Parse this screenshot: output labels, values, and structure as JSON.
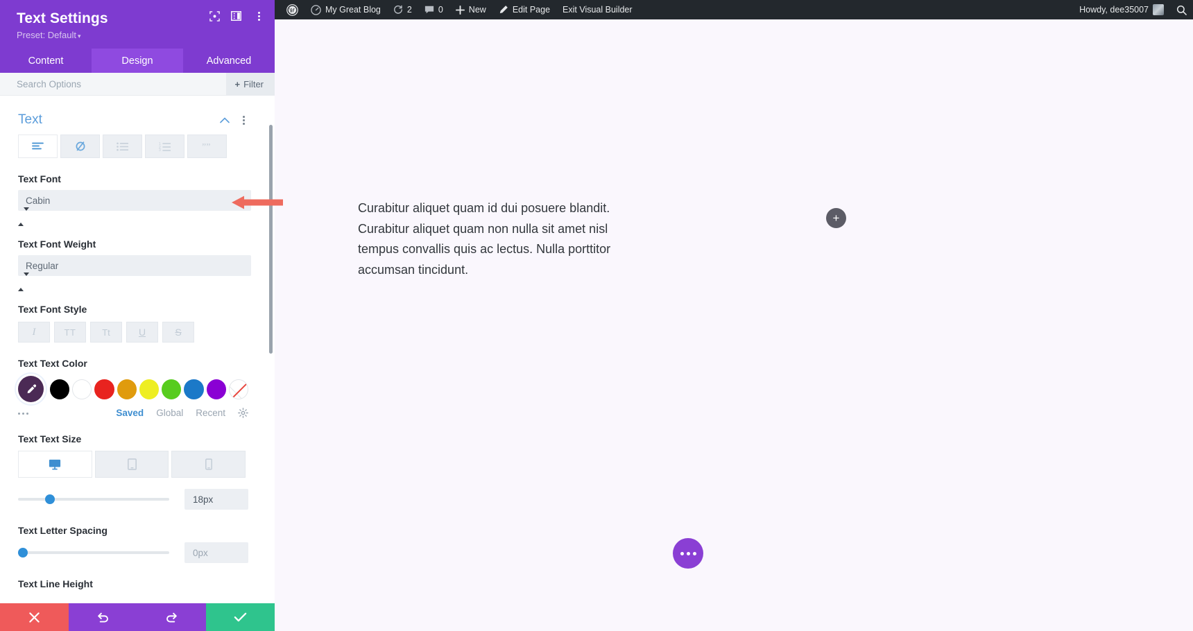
{
  "panel": {
    "title": "Text Settings",
    "preset_label": "Preset: Default",
    "preset_caret": "▾",
    "header_icons": [
      "focus-frame-icon",
      "layout-columns-icon",
      "kebab-menu-icon"
    ],
    "tabs": [
      {
        "label": "Content",
        "active": false
      },
      {
        "label": "Design",
        "active": true
      },
      {
        "label": "Advanced",
        "active": false
      }
    ],
    "search": {
      "placeholder": "Search Options",
      "value": ""
    },
    "filter_button": {
      "plus": "+",
      "label": "Filter"
    },
    "section": {
      "title": "Text",
      "collapse_icon": "chevron-up-icon",
      "menu_icon": "kebab-menu-icon"
    },
    "align_buttons": [
      {
        "name": "text-align-left",
        "active": true
      },
      {
        "name": "text-orientation",
        "active": false
      },
      {
        "name": "unordered-list",
        "active": false
      },
      {
        "name": "ordered-list",
        "active": false
      },
      {
        "name": "blockquote",
        "active": false
      }
    ],
    "fields": {
      "text_font": {
        "label": "Text Font",
        "value": "Cabin"
      },
      "text_font_weight": {
        "label": "Text Font Weight",
        "value": "Regular"
      },
      "text_font_style": {
        "label": "Text Font Style",
        "buttons": [
          {
            "name": "italic",
            "glyph": "I",
            "active": false
          },
          {
            "name": "uppercase",
            "glyph": "TT",
            "active": false
          },
          {
            "name": "capitalize",
            "glyph": "Tt",
            "active": false
          },
          {
            "name": "underline",
            "glyph": "U",
            "active": false
          },
          {
            "name": "strikethrough",
            "glyph": "S",
            "active": false
          }
        ]
      },
      "text_text_color": {
        "label": "Text Text Color",
        "selected_swatch": "#4b2a55",
        "swatches": [
          "#000000",
          "#ffffff",
          "#e8231f",
          "#e09b0d",
          "#eeee22",
          "#57cc1e",
          "#1b79c8",
          "#8a00d4",
          "none"
        ],
        "more_icon": "ellipsis-horizontal-icon",
        "tabs": [
          {
            "label": "Saved",
            "active": true
          },
          {
            "label": "Global",
            "active": false
          },
          {
            "label": "Recent",
            "active": false
          }
        ],
        "settings_icon": "gear-icon"
      },
      "text_text_size": {
        "label": "Text Text Size",
        "devices": [
          {
            "name": "desktop",
            "active": true
          },
          {
            "name": "tablet",
            "active": false
          },
          {
            "name": "phone",
            "active": false
          }
        ],
        "value": "18px",
        "slider_percent": 18
      },
      "text_letter_spacing": {
        "label": "Text Letter Spacing",
        "value": "0px",
        "slider_percent": 2
      },
      "text_line_height": {
        "label": "Text Line Height"
      }
    },
    "actions": [
      {
        "name": "cancel",
        "glyph": "✕",
        "color": "#ef5a5a"
      },
      {
        "name": "undo",
        "glyph": "↺",
        "color": "#8a3fd4"
      },
      {
        "name": "redo",
        "glyph": "↻",
        "color": "#8a3fd4"
      },
      {
        "name": "save",
        "glyph": "✔",
        "color": "#2fc48d"
      }
    ]
  },
  "adminbar": {
    "items": [
      {
        "name": "wordpress-logo",
        "label": ""
      },
      {
        "name": "site-name",
        "label": "My Great Blog"
      },
      {
        "name": "updates",
        "label": "2"
      },
      {
        "name": "comments",
        "label": "0"
      },
      {
        "name": "new-content",
        "label": "New"
      },
      {
        "name": "edit-page",
        "label": "Edit Page"
      },
      {
        "name": "exit-visual-builder",
        "label": "Exit Visual Builder"
      }
    ],
    "howdy": "Howdy, dee35007",
    "search_icon": "search-icon"
  },
  "canvas": {
    "paragraph": "Curabitur aliquet quam id dui posuere blandit. Curabitur aliquet quam non nulla sit amet nisl tempus convallis quis ac lectus. Nulla porttitor accumsan tincidunt.",
    "add_button_glyph": "+",
    "fab_name": "more-options-fab"
  },
  "annotation": {
    "arrow_color": "#ee6b5e",
    "points_to": "text-font-select"
  }
}
